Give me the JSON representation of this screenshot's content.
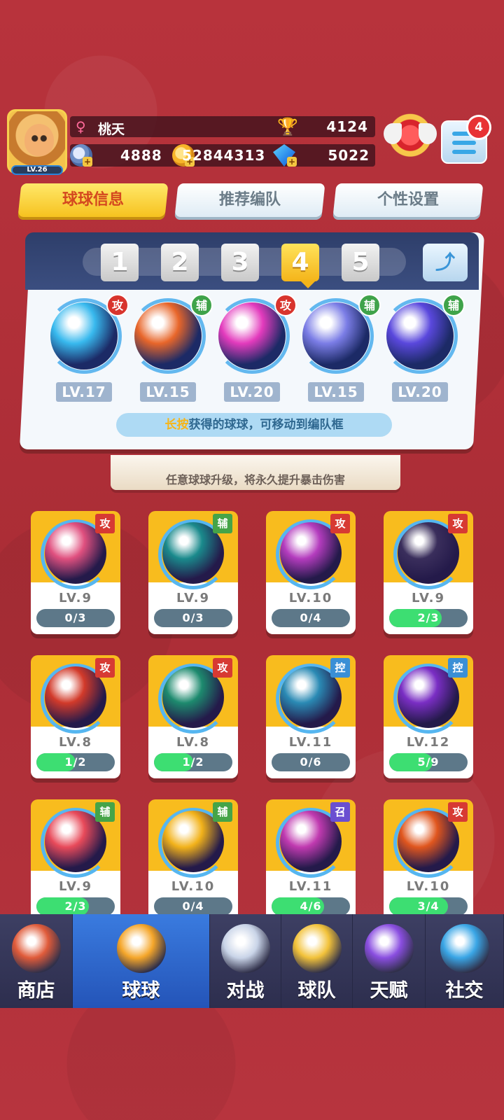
{
  "player": {
    "name": "桃天",
    "level": "LV.26",
    "trophies": "4124",
    "tickets": "4888",
    "coins": "52844313",
    "gems": "5022",
    "notification_count": "4"
  },
  "tabs": [
    {
      "label": "球球信息",
      "active": true
    },
    {
      "label": "推荐编队",
      "active": false
    },
    {
      "label": "个性设置",
      "active": false
    }
  ],
  "team": {
    "slots": [
      "1",
      "2",
      "3",
      "4",
      "5"
    ],
    "active_slot": "4",
    "balls": [
      {
        "type": "攻",
        "level": "LV.17",
        "color": "#38b9ee"
      },
      {
        "type": "辅",
        "level": "LV.15",
        "color": "#e8662a"
      },
      {
        "type": "攻",
        "level": "LV.20",
        "color": "#e33bbd"
      },
      {
        "type": "辅",
        "level": "LV.15",
        "color": "#7b7de6"
      },
      {
        "type": "辅",
        "level": "LV.20",
        "color": "#5a48dd"
      }
    ],
    "hint_highlight": "长按",
    "hint_rest": "获得的球球，可移动到编队框"
  },
  "crit_banner": {
    "text": "任意球球升级，将永久提升暴击伤害"
  },
  "cards": [
    {
      "type": "攻",
      "type_kind": "atk",
      "level": "LV.9",
      "progress": "0/3",
      "fill": 0,
      "color": "#e0507f"
    },
    {
      "type": "辅",
      "type_kind": "sup",
      "level": "LV.9",
      "progress": "0/3",
      "fill": 0,
      "color": "#1a8a8c"
    },
    {
      "type": "攻",
      "type_kind": "atk",
      "level": "LV.10",
      "progress": "0/4",
      "fill": 0,
      "color": "#b43cbe"
    },
    {
      "type": "攻",
      "type_kind": "atk",
      "level": "LV.9",
      "progress": "2/3",
      "fill": 0.667,
      "color": "#3a2e5c"
    },
    {
      "type": "攻",
      "type_kind": "atk",
      "level": "LV.8",
      "progress": "1/2",
      "fill": 0.5,
      "color": "#d23a2a"
    },
    {
      "type": "攻",
      "type_kind": "atk",
      "level": "LV.8",
      "progress": "1/2",
      "fill": 0.5,
      "color": "#1d8a6e"
    },
    {
      "type": "控",
      "type_kind": "ctl",
      "level": "LV.11",
      "progress": "0/6",
      "fill": 0,
      "color": "#2a8ab4"
    },
    {
      "type": "控",
      "type_kind": "ctl",
      "level": "LV.12",
      "progress": "5/9",
      "fill": 0.556,
      "color": "#7a2ec4"
    },
    {
      "type": "辅",
      "type_kind": "sup",
      "level": "LV.9",
      "progress": "2/3",
      "fill": 0.667,
      "color": "#e84a5a"
    },
    {
      "type": "辅",
      "type_kind": "sup",
      "level": "LV.10",
      "progress": "0/4",
      "fill": 0,
      "color": "#f2b21a"
    },
    {
      "type": "召",
      "type_kind": "sum",
      "level": "LV.11",
      "progress": "4/6",
      "fill": 0.667,
      "color": "#c03ab0"
    },
    {
      "type": "攻",
      "type_kind": "atk",
      "level": "LV.10",
      "progress": "3/4",
      "fill": 0.75,
      "color": "#e0561e"
    }
  ],
  "nav": [
    {
      "label": "商店",
      "icon": "shop-icon",
      "active": false
    },
    {
      "label": "球球",
      "icon": "ball-icon",
      "active": true
    },
    {
      "label": "对战",
      "icon": "swords-icon",
      "active": false
    },
    {
      "label": "球队",
      "icon": "whistle-icon",
      "active": false
    },
    {
      "label": "天赋",
      "icon": "planet-icon",
      "active": false
    },
    {
      "label": "社交",
      "icon": "chat-heart-icon",
      "active": false
    }
  ]
}
